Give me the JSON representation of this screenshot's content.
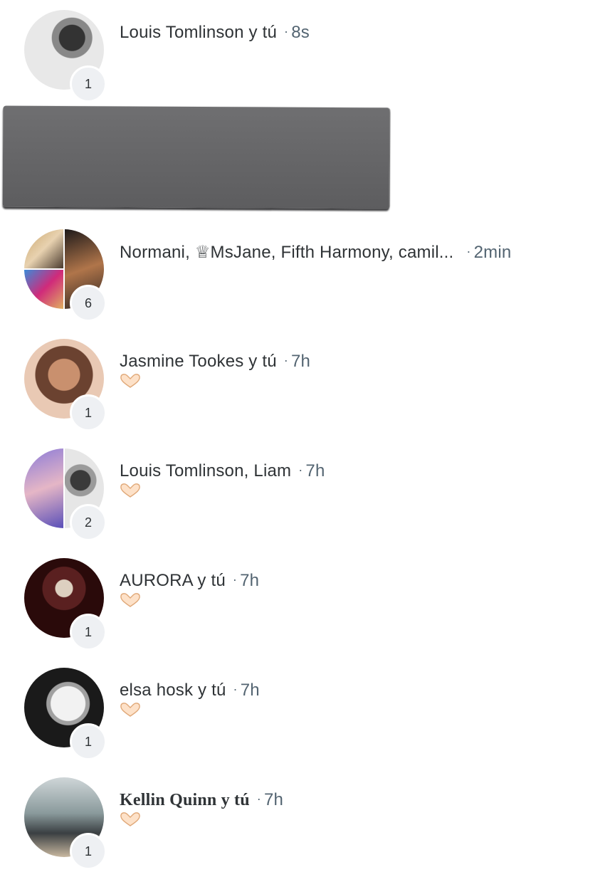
{
  "conversations": [
    {
      "title": "Louis Tomlinson y tú",
      "time": "8s",
      "count": "1",
      "preview": "",
      "avatar": "louis-tomlinson-avatar"
    },
    {
      "title": "Normani, ♕MsJane, Fifth Harmony, camil...",
      "time": "2min",
      "count": "6",
      "preview": "",
      "avatar": "group-avatar"
    },
    {
      "title": "Jasmine Tookes y tú",
      "time": "7h",
      "count": "1",
      "preview": "heart-hands-emoji",
      "avatar": "jasmine-tookes-avatar"
    },
    {
      "title": "Louis Tomlinson, Liam",
      "time": "7h",
      "count": "2",
      "preview": "heart-hands-emoji",
      "avatar": "louis-liam-avatar"
    },
    {
      "title": "AURORA y tú",
      "time": "7h",
      "count": "1",
      "preview": "heart-hands-emoji",
      "avatar": "aurora-avatar"
    },
    {
      "title": "elsa hosk y tú",
      "time": "7h",
      "count": "1",
      "preview": "heart-hands-emoji",
      "avatar": "elsa-hosk-avatar"
    },
    {
      "title": "Kellin Quinn y tú",
      "time": "7h",
      "count": "1",
      "preview": "heart-hands-emoji",
      "avatar": "kellin-quinn-avatar"
    }
  ],
  "separator": "·",
  "colors": {
    "text": "#2f3336",
    "muted": "#536471",
    "badge_bg": "#eef0f3",
    "redaction": "#636365"
  }
}
